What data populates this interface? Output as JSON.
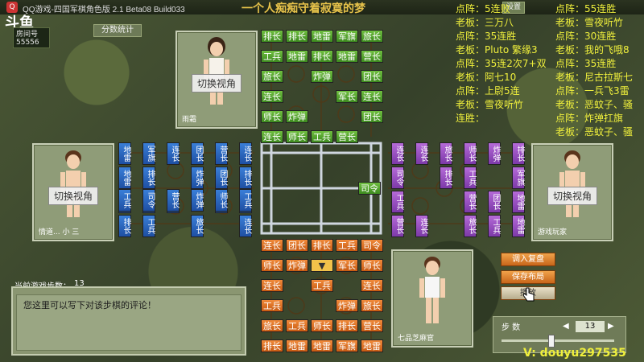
{
  "window": {
    "title": "QQ游戏-四国军棋角色版 2.1 Beta08 Build033",
    "marquee": "一个人痴痴守着寂寞的梦",
    "settings_label": "设置",
    "logo": "斗鱼"
  },
  "room": {
    "label": "房间号",
    "number": "55556",
    "stats_label": "分数统计"
  },
  "players": {
    "top": {
      "switch_label": "切换视角",
      "name": "雨霜"
    },
    "left": {
      "switch_label": "切换视角",
      "name": "情道... 小 三"
    },
    "right": {
      "switch_label": "切换视角",
      "name": "游戏玩家"
    },
    "bottom": {
      "name": "七品芝麻官"
    }
  },
  "board": {
    "top_green": [
      [
        "排长",
        "排长",
        "地雷",
        "军旗",
        "旅长"
      ],
      [
        "工兵",
        "地雷",
        "排长",
        "地雷",
        "营长"
      ],
      [
        "旅长",
        "",
        "炸弹",
        "",
        "团长"
      ],
      [
        "连长",
        "",
        "",
        "军长",
        "连长"
      ],
      [
        "师长",
        "炸弹",
        "",
        "",
        "团长"
      ],
      [
        "连长",
        "师长",
        "工兵",
        "营长",
        ""
      ]
    ],
    "bottom_orange": [
      [
        "连长",
        "团长",
        "排长",
        "工兵",
        "司令"
      ],
      [
        "师长",
        "炸弹",
        "▼",
        "军长",
        "师长"
      ],
      [
        "连长",
        "",
        "工兵",
        "",
        "连长"
      ],
      [
        "工兵",
        "",
        "",
        "炸弹",
        "旅长"
      ],
      [
        "旅长",
        "工兵",
        "师长",
        "排长",
        "营长"
      ],
      [
        "排长",
        "地雷",
        "地雷",
        "军旗",
        "地雷"
      ]
    ],
    "left_blue": [
      [
        "地雷",
        "军旗",
        "连长",
        "团长",
        "营长",
        "连长"
      ],
      [
        "地雷",
        "排长",
        "",
        "炸弹",
        "团长",
        "排长"
      ],
      [
        "地雷",
        "师长",
        "连长",
        "",
        "工兵",
        "营长"
      ],
      [
        "排长",
        "工兵",
        "",
        "旅长",
        "",
        "连长"
      ],
      [
        "工兵",
        "司令",
        "营长",
        "炸弹",
        "师长",
        "工兵"
      ]
    ],
    "right_purple": [
      [
        "连长",
        "连长",
        "旅长",
        "师长",
        "炸弹",
        "排长"
      ],
      [
        "司令",
        "",
        "排长",
        "工兵",
        "",
        "军旗"
      ],
      [
        "工兵",
        "",
        "",
        "营长",
        "团长",
        "地雷"
      ],
      [
        "营长",
        "连长",
        "",
        "旅长",
        "工兵",
        "地雷"
      ],
      [
        "排长",
        "炸弹",
        "师长",
        "营长",
        "排长",
        "地雷"
      ]
    ],
    "center_piece": "司令"
  },
  "game": {
    "steps_label": "当前游戏步数：",
    "steps_count": "13",
    "comment_placeholder": "您这里可以写下对该步棋的评论！"
  },
  "actions": {
    "load": "调入复盘",
    "save": "保存布局",
    "play": "播放"
  },
  "stepper": {
    "label": "步 数",
    "value": "13"
  },
  "overlay": {
    "left_col": [
      "点阵：5连败",
      "老板：三万八",
      "点阵：35连胜",
      "老板：Pluto 繁缘3",
      "点阵：35连2次7+双",
      "老板：阿七10",
      "点阵：上尉5连",
      "老板：雪夜听竹",
      "连胜："
    ],
    "right_col": [
      "点阵：55连胜",
      "老板：雪夜听竹",
      "点阵：30连胜",
      "老板：我的飞哦8",
      "点阵：35连胜",
      "老板：尼古拉斯七",
      "点阵：一兵飞3雷",
      "老板：恶蚊子、骚",
      "点阵：炸弹扛旗",
      "老板：恶蚊子、骚"
    ],
    "watermark": "V: douyu297535"
  }
}
